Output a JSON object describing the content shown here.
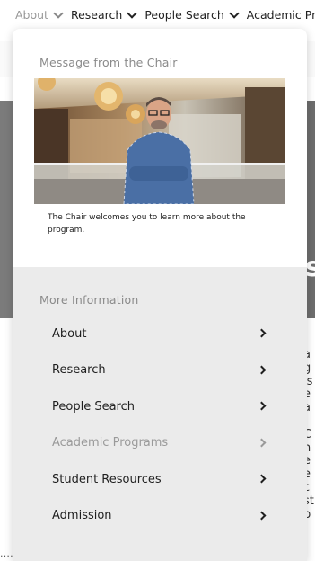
{
  "top_nav": {
    "items": [
      {
        "label": "About"
      },
      {
        "label": "Research"
      },
      {
        "label": "People Search"
      },
      {
        "label": "Academic Pro"
      }
    ]
  },
  "dropdown": {
    "chair_section": {
      "title": "Message from the Chair",
      "caption": "The Chair welcomes you to learn more about the program."
    },
    "more_info": {
      "title": "More Information",
      "items": [
        {
          "label": "About"
        },
        {
          "label": "Research"
        },
        {
          "label": "People Search"
        },
        {
          "label": "Academic Programs"
        },
        {
          "label": "Student Resources"
        },
        {
          "label": "Admission"
        }
      ]
    }
  }
}
